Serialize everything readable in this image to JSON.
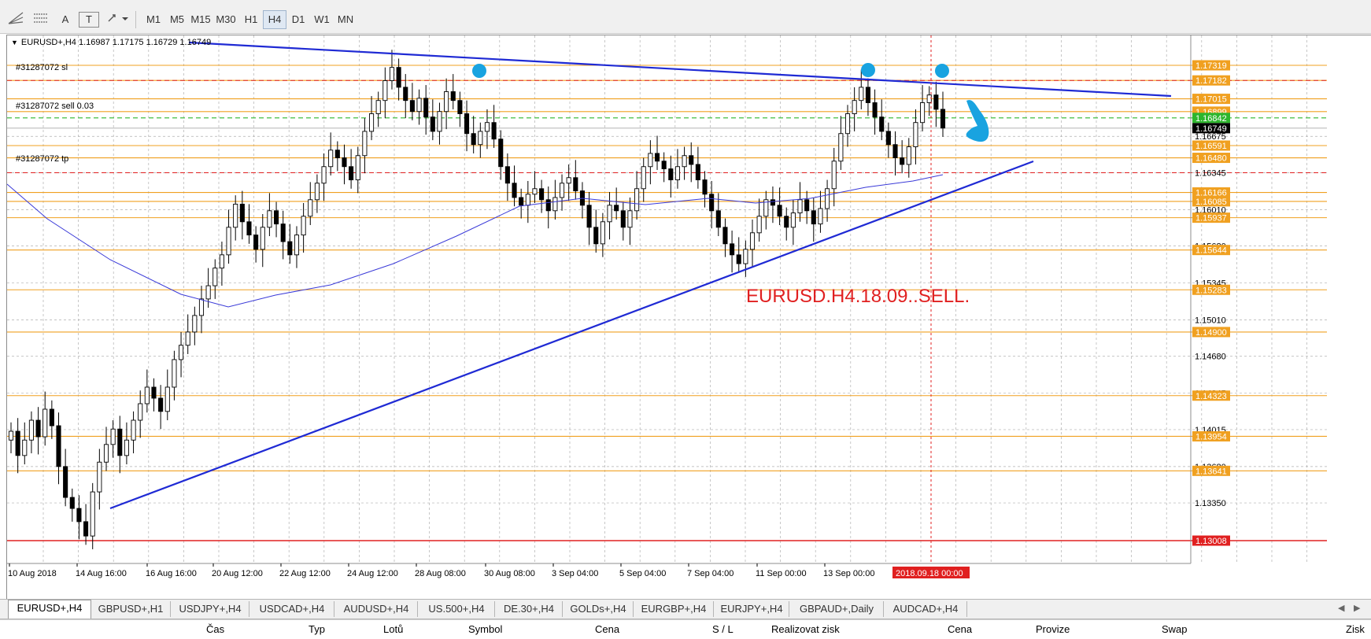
{
  "toolbar": {
    "timeframes": [
      "M1",
      "M5",
      "M15",
      "M30",
      "H1",
      "H4",
      "D1",
      "W1",
      "MN"
    ],
    "active_timeframe": "H4",
    "tools": [
      "A",
      "T"
    ]
  },
  "chart": {
    "header": "EURUSD+,H4  1.16987 1.17175 1.16729 1.16749",
    "annotation": "EURUSD.H4.18.09..SELL.",
    "orders": {
      "sl": "#31287072 sl",
      "sell": "#31287072 sell 0.03",
      "tp": "#31287072 tp"
    },
    "price_tags": [
      {
        "value": "1.17319",
        "kind": "level"
      },
      {
        "value": "1.17182",
        "kind": "level"
      },
      {
        "value": "1.17015",
        "kind": "level"
      },
      {
        "value": "1.16899",
        "kind": "level"
      },
      {
        "value": "1.16842",
        "kind": "green"
      },
      {
        "value": "1.16749",
        "kind": "current"
      },
      {
        "value": "1.16591",
        "kind": "level"
      },
      {
        "value": "1.16480",
        "kind": "level"
      },
      {
        "value": "1.16166",
        "kind": "level"
      },
      {
        "value": "1.16085",
        "kind": "level"
      },
      {
        "value": "1.15937",
        "kind": "level"
      },
      {
        "value": "1.15644",
        "kind": "level"
      },
      {
        "value": "1.15283",
        "kind": "level"
      },
      {
        "value": "1.14900",
        "kind": "level"
      },
      {
        "value": "1.14323",
        "kind": "level"
      },
      {
        "value": "1.13954",
        "kind": "level"
      },
      {
        "value": "1.13641",
        "kind": "level"
      },
      {
        "value": "1.13008",
        "kind": "red"
      }
    ],
    "axis_prices": [
      "1.16675",
      "1.16345",
      "1.16010",
      "1.15680",
      "1.15345",
      "1.15010",
      "1.14680",
      "1.14345",
      "1.14015",
      "1.13680",
      "1.13350"
    ],
    "time_labels": [
      "10 Aug 2018",
      "14 Aug 16:00",
      "16 Aug 16:00",
      "20 Aug 12:00",
      "22 Aug 12:00",
      "24 Aug 12:00",
      "28 Aug 08:00",
      "30 Aug 08:00",
      "3 Sep 04:00",
      "5 Sep 04:00",
      "7 Sep 04:00",
      "11 Sep 00:00",
      "13 Sep 00:00"
    ],
    "time_cursor": "2018.09.18 00:00",
    "colors": {
      "trendline": "#1f2ad4",
      "ma": "#3a3ad8",
      "level": "#f0a020",
      "annotation": "#e02020",
      "marker": "#19a3e0",
      "grid": "#b0b0b0"
    }
  },
  "tabs": [
    "EURUSD+,H4",
    "GBPUSD+,H1",
    "USDJPY+,H4",
    "USDCAD+,H4",
    "AUDUSD+,H4",
    "US.500+,H4",
    "DE.30+,H4",
    "GOLDs+,H4",
    "EURGBP+,H4",
    "EURJPY+,H4",
    "GBPAUD+,Daily",
    "AUDCAD+,H4"
  ],
  "active_tab": "EURUSD+,H4",
  "columns": [
    "Čas",
    "Typ",
    "Lotů",
    "Symbol",
    "Cena",
    "S / L",
    "Realizovat zisk",
    "Cena",
    "Provize",
    "Swap",
    "Zisk"
  ]
}
